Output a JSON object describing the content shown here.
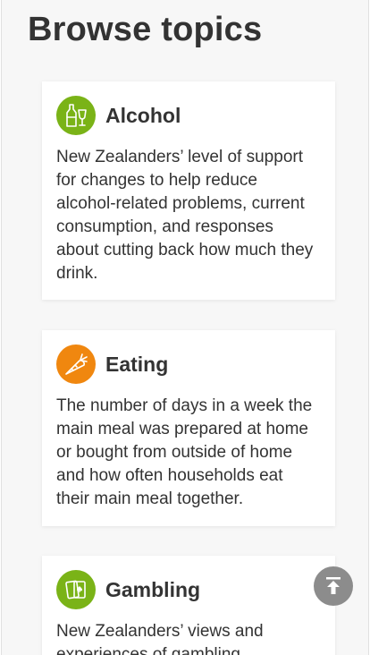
{
  "page": {
    "title": "Browse topics"
  },
  "cards": [
    {
      "title": "Alcohol",
      "icon": "bottle-and-glass-icon",
      "icon_color": "#7ab317",
      "description": "New Zealanders’ level of support for changes to help reduce alcohol-related problems, current consumption, and responses about cutting back how much they drink."
    },
    {
      "title": "Eating",
      "icon": "carrot-icon",
      "icon_color": "#f0870f",
      "description": "The number of days in a week the main meal was prepared at home or bought from outside of home and how often households eat their main meal together."
    },
    {
      "title": "Gambling",
      "icon": "playing-cards-icon",
      "icon_color": "#7ab317",
      "description": "New Zealanders’ views and experiences of gambling..."
    }
  ],
  "back_to_top": {
    "icon": "arrow-up-to-line-icon",
    "color": "#8c8c8c"
  }
}
